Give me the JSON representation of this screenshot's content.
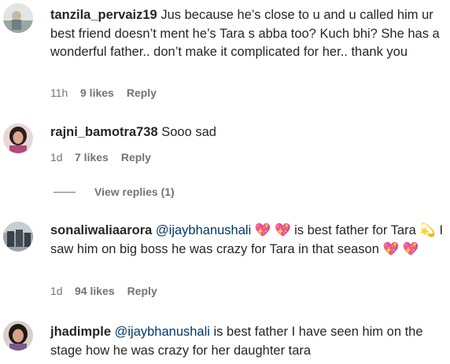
{
  "comments": [
    {
      "username": "tanzila_pervaiz19",
      "text": " Jus because he’s close to u and u called him ur best friend doesn’t ment he’s Tara s abba too? Kuch bhi? She has a wonderful father.. don’t make it complicated for her.. thank you",
      "time": "11h",
      "likes": "9 likes",
      "reply": "Reply"
    },
    {
      "username": "rajni_bamotra738",
      "text": " Sooo sad",
      "time": "1d",
      "likes": "7 likes",
      "reply": "Reply"
    },
    {
      "username": "sonaliwaliaarora",
      "mention": "@ijaybhanushali",
      "text_after_mention": " 💖 💖 is best father for Tara 💫 I saw him on big boss he was crazy for Tara in that season 💖 💖",
      "time": "1d",
      "likes": "94 likes",
      "reply": "Reply"
    },
    {
      "username": "jhadimple",
      "mention": "@ijaybhanushali",
      "text_after_mention": " is best father I have seen him on the stage how he was crazy for her daughter tara"
    }
  ],
  "view_replies": "View replies (1)",
  "colors": {
    "text": "#262626",
    "meta": "#737373",
    "mention": "#00376b"
  }
}
